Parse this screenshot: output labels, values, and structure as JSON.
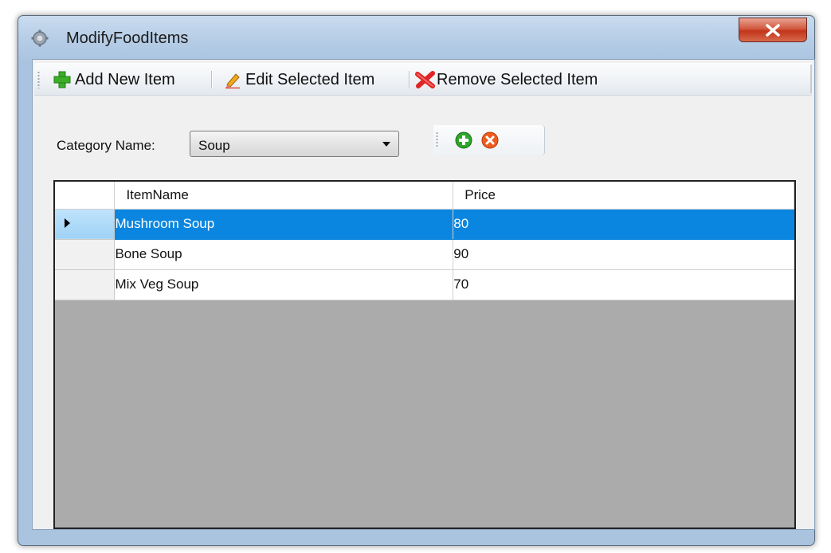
{
  "window": {
    "title": "ModifyFoodItems"
  },
  "toolbar": {
    "add_label": "Add New Item",
    "edit_label": "Edit Selected Item",
    "remove_label": "Remove Selected Item"
  },
  "category": {
    "label": "Category Name:",
    "selected": "Soup"
  },
  "grid": {
    "columns": [
      "ItemName",
      "Price"
    ],
    "rows": [
      {
        "name": "Mushroom Soup",
        "price": "80",
        "selected": true
      },
      {
        "name": "Bone Soup",
        "price": "90",
        "selected": false
      },
      {
        "name": "Mix Veg Soup",
        "price": "70",
        "selected": false
      }
    ]
  },
  "colors": {
    "selection": "#0a86e0",
    "grid_background": "#ababab",
    "close_button": "#c2351b"
  },
  "icons": {
    "app": "gear-icon",
    "add": "plus-icon",
    "edit": "pencil-icon",
    "remove": "x-mark-icon",
    "mini_add": "add-circle-icon",
    "mini_remove": "remove-circle-icon"
  }
}
